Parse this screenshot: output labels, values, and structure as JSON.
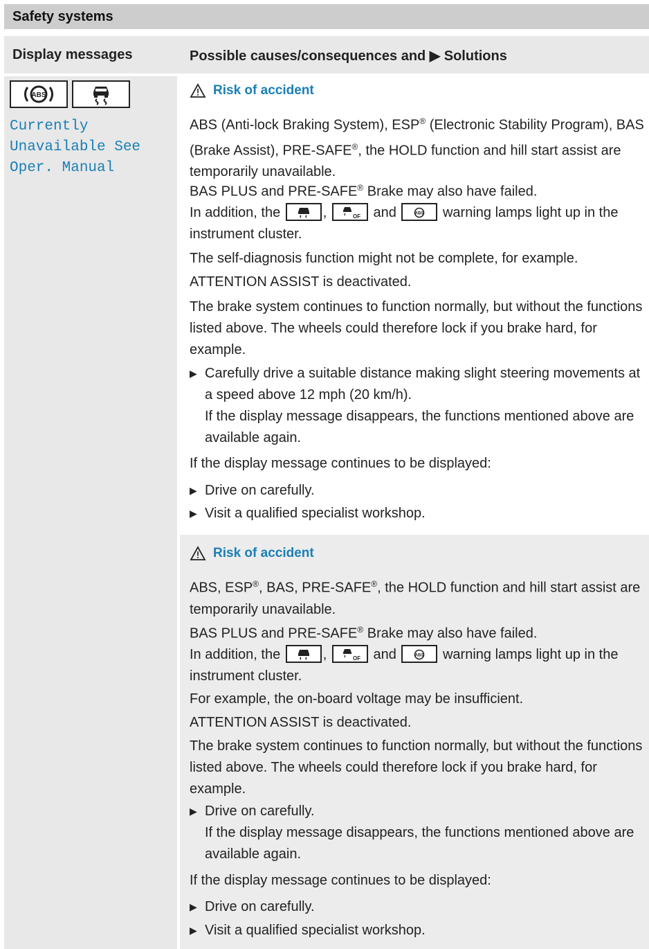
{
  "header": {
    "title": "Safety systems"
  },
  "columns": {
    "left": "Display messages",
    "right": "Possible causes/consequences and ▶ Solutions"
  },
  "left": {
    "icons": [
      "abs-icon",
      "esp-skid-icon"
    ],
    "message_lines": [
      "Currently",
      "Unavailable See",
      "Oper. Manual"
    ]
  },
  "section1": {
    "warning_title": "Risk of accident",
    "p1": "ABS (Anti-lock Braking System), ESP® (Electronic Stability Program), BAS (Brake Assist), PRE-SAFE®, the HOLD function and hill start assist are temporarily unavailable.",
    "p2": "BAS PLUS and PRE-SAFE® Brake may also have failed.",
    "lamp_prefix": "In addition, the",
    "lamp_sep1": ",",
    "lamp_sep2": "and",
    "lamp_suffix": "warning lamps light up in the instrument cluster.",
    "p4": "The self-diagnosis function might not be complete, for example.",
    "p5": "ATTENTION ASSIST is deactivated.",
    "p6": "The brake system continues to function normally, but without the functions listed above. The wheels could therefore lock if you brake hard, for example.",
    "b1": "Carefully drive a suitable distance making slight steering movements at a speed above 12 mph (20 km/h).",
    "b1_note": "If the display message disappears, the functions mentioned above are available again.",
    "p7": "If the display message continues to be displayed:",
    "b2": "Drive on carefully.",
    "b3": "Visit a qualified specialist workshop."
  },
  "section2": {
    "warning_title": "Risk of accident",
    "p1": "ABS, ESP®, BAS, PRE-SAFE®, the HOLD function and hill start assist are temporarily unavailable.",
    "p2": "BAS PLUS and PRE-SAFE® Brake may also have failed.",
    "lamp_prefix": "In addition, the",
    "lamp_sep1": ",",
    "lamp_sep2": "and",
    "lamp_suffix": "warning lamps light up in the instrument cluster.",
    "p4": "For example, the on-board voltage may be insufficient.",
    "p5": "ATTENTION ASSIST is deactivated.",
    "p6": "The brake system continues to function normally, but without the functions listed above. The wheels could therefore lock if you brake hard, for example.",
    "b1": "Drive on carefully.",
    "b1_note": "If the display message disappears, the functions mentioned above are available again.",
    "p7": "If the display message continues to be displayed:",
    "b2": "Drive on carefully.",
    "b3": "Visit a qualified specialist workshop."
  },
  "colors": {
    "accent": "#1a7fb5",
    "header_bg": "#cdcdcd",
    "panel_bg": "#e8e8e8"
  }
}
